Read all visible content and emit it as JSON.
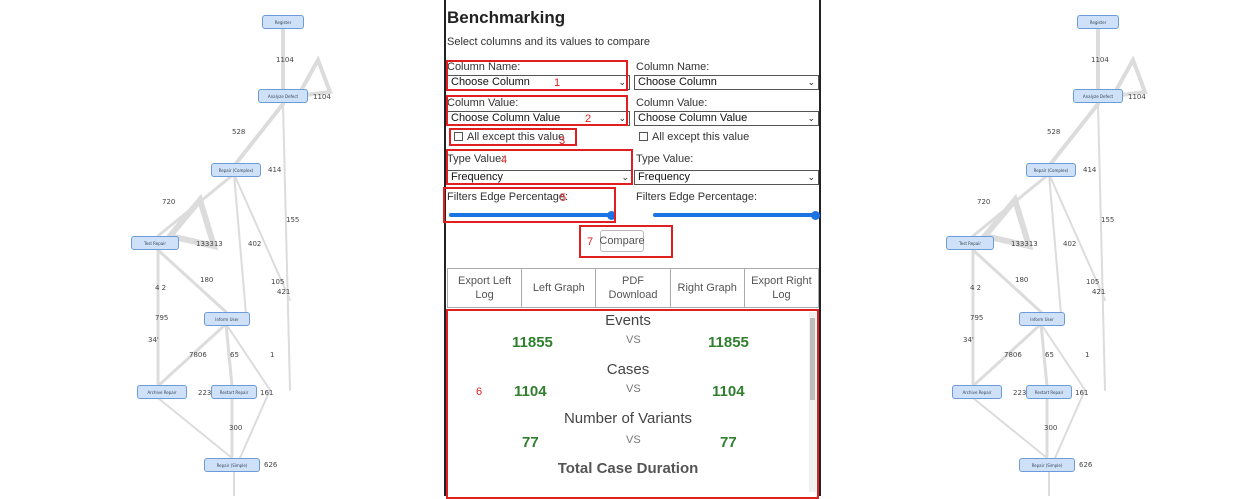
{
  "benchmark": {
    "title": "Benchmarking",
    "subtitle": "Select columns and its values to compare",
    "left": {
      "column_name_label": "Column Name:",
      "column_name_value": "Choose Column",
      "column_value_label": "Column Value:",
      "column_value_value": "Choose Column Value",
      "except_label": "All except this value",
      "type_label": "Type Value:",
      "type_value": "Frequency",
      "filter_label": "Filters Edge Percentage:",
      "filter_percent": 100
    },
    "right": {
      "column_name_label": "Column Name:",
      "column_name_value": "Choose Column",
      "column_value_label": "Column Value:",
      "column_value_value": "Choose Column Value",
      "except_label": "All except this value",
      "type_label": "Type Value:",
      "type_value": "Frequency",
      "filter_label": "Filters Edge Percentage:",
      "filter_percent": 100
    },
    "compare_label": "Compare",
    "tabs": [
      "Export Left Log",
      "Left Graph",
      "PDF Download",
      "Right Graph",
      "Export Right Log"
    ],
    "annotations": [
      "1",
      "2",
      "3",
      "4",
      "5",
      "6",
      "7"
    ],
    "stats": [
      {
        "label": "Events",
        "left": "11855",
        "vs": "VS",
        "right": "11855"
      },
      {
        "label": "Cases",
        "left": "1104",
        "vs": "VS",
        "right": "1104"
      },
      {
        "label": "Number of Variants",
        "left": "77",
        "vs": "VS",
        "right": "77"
      },
      {
        "label": "Total Case Duration"
      }
    ]
  },
  "graph": {
    "nodes": [
      "Register",
      "Analyze Defect",
      "Repair (Complex)",
      "Test Repair",
      "Inform User",
      "Archive Repair",
      "Restart Repair",
      "Repair (Simple)"
    ],
    "edge_labels": [
      "1104",
      "1104",
      "528",
      "414",
      "720",
      "155",
      "133313",
      "402",
      "180",
      "4 2",
      "105",
      "421",
      "795",
      "34'",
      "7806",
      "65",
      "1",
      "223",
      "161",
      "300",
      "626"
    ]
  },
  "colors": {
    "accent": "#1b74e4",
    "highlight": "#e02020",
    "value_green": "#2f7f2f",
    "node_fill": "#cfe1f8"
  }
}
